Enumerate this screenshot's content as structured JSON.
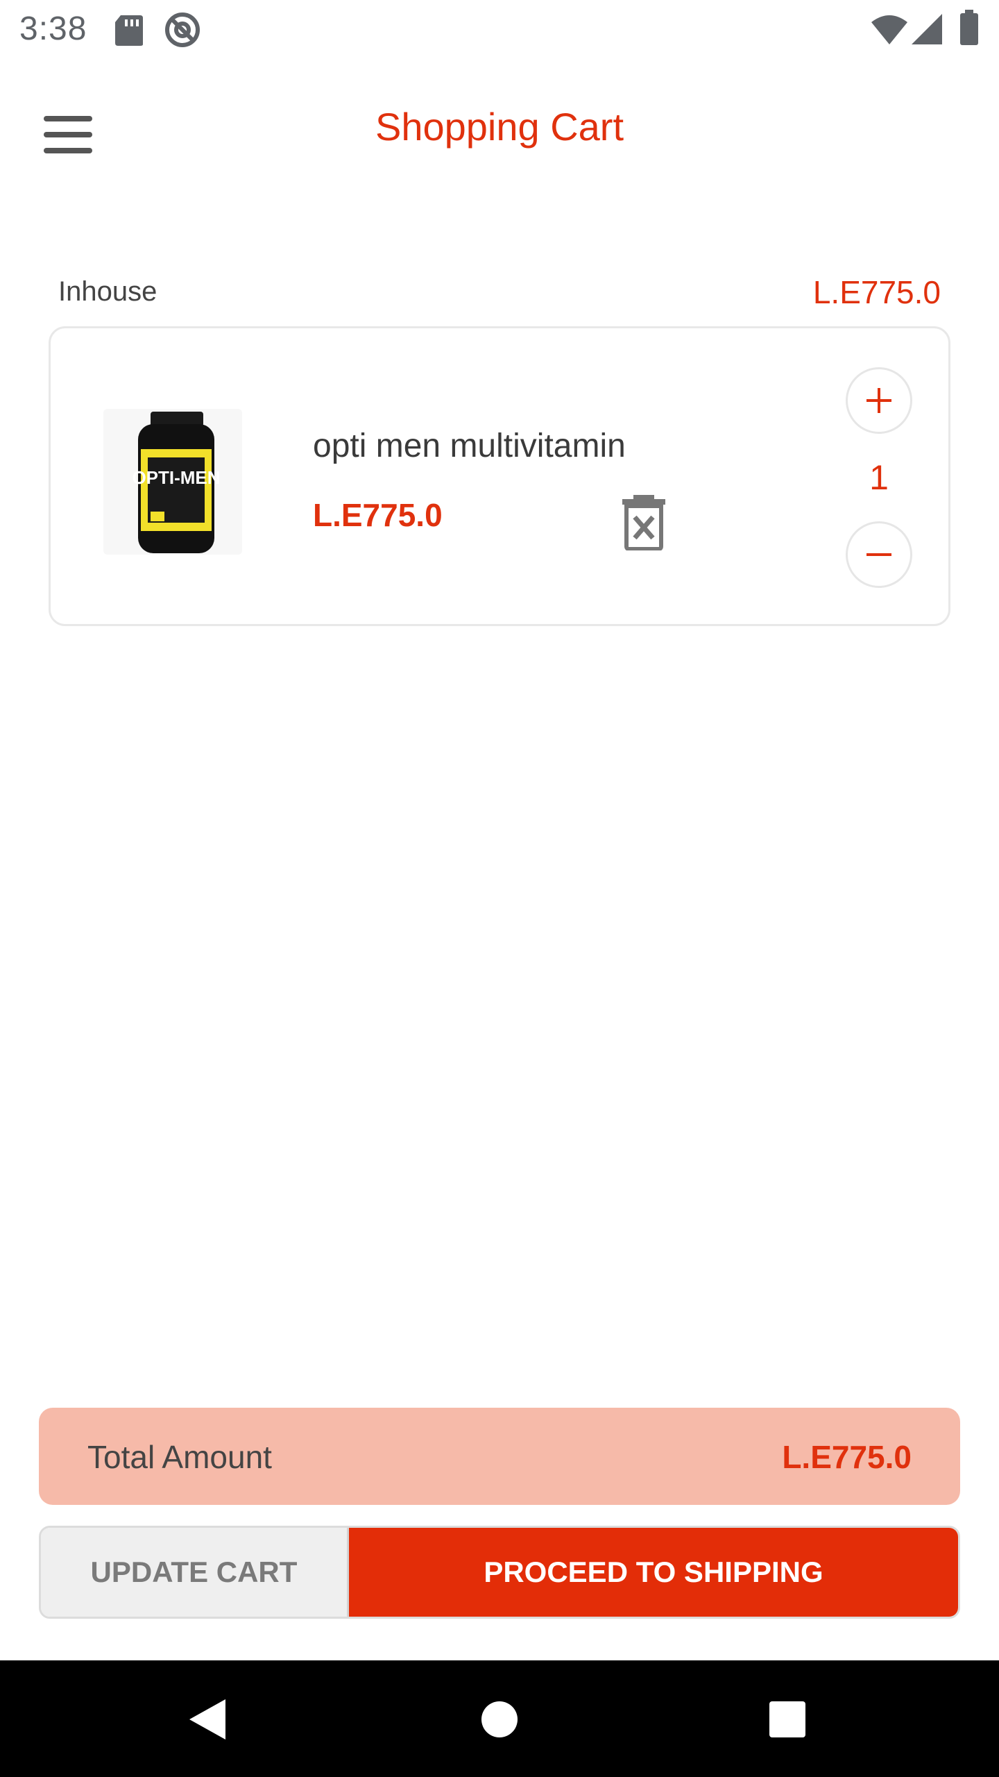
{
  "status_bar": {
    "time": "3:38",
    "icons": [
      "sd-card-icon",
      "at-sign-icon",
      "wifi-icon",
      "signal-icon",
      "battery-icon"
    ]
  },
  "header": {
    "title": "Shopping Cart",
    "menu_icon": "hamburger-menu-icon"
  },
  "seller": {
    "name": "Inhouse",
    "total": "L.E775.0"
  },
  "cart_items": [
    {
      "name": "opti men multivitamin",
      "price": "L.E775.0",
      "quantity": "1",
      "image_label": "OPTI-MEN"
    }
  ],
  "summary": {
    "total_label": "Total Amount",
    "total_value": "L.E775.0"
  },
  "actions": {
    "update_label": "UPDATE CART",
    "proceed_label": "PROCEED TO SHIPPING"
  },
  "colors": {
    "accent": "#e0310d",
    "total_bg": "#f6baa9",
    "proceed_bg": "#e32d08"
  }
}
